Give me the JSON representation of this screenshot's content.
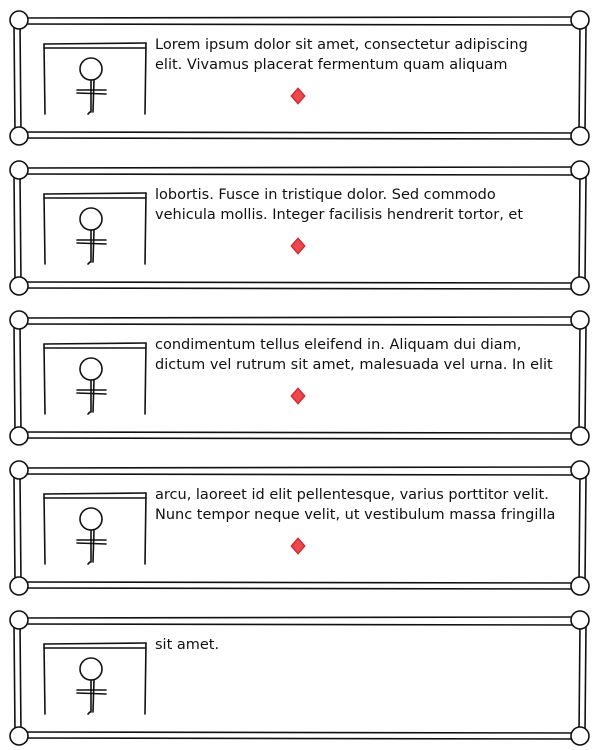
{
  "colors": {
    "ink": "#111111",
    "marker": "#e8393f",
    "background": "#ffffff"
  },
  "cards": [
    {
      "text": "Lorem ipsum dolor sit amet, consectetur adipiscing\nelit. Vivamus placerat fermentum quam aliquam",
      "icon": "stick-figure-icon",
      "has_marker": true
    },
    {
      "text": "lobortis. Fusce in tristique dolor. Sed commodo\nvehicula mollis. Integer facilisis hendrerit tortor, et",
      "icon": "stick-figure-icon",
      "has_marker": true
    },
    {
      "text": "condimentum tellus eleifend in. Aliquam dui diam,\ndictum vel rutrum sit amet, malesuada vel urna. In elit",
      "icon": "stick-figure-icon",
      "has_marker": true
    },
    {
      "text": "arcu, laoreet id elit pellentesque, varius porttitor velit.\nNunc tempor neque velit, ut vestibulum massa fringilla",
      "icon": "stick-figure-icon",
      "has_marker": true
    },
    {
      "text": "sit amet.",
      "icon": "stick-figure-icon",
      "has_marker": false
    }
  ]
}
